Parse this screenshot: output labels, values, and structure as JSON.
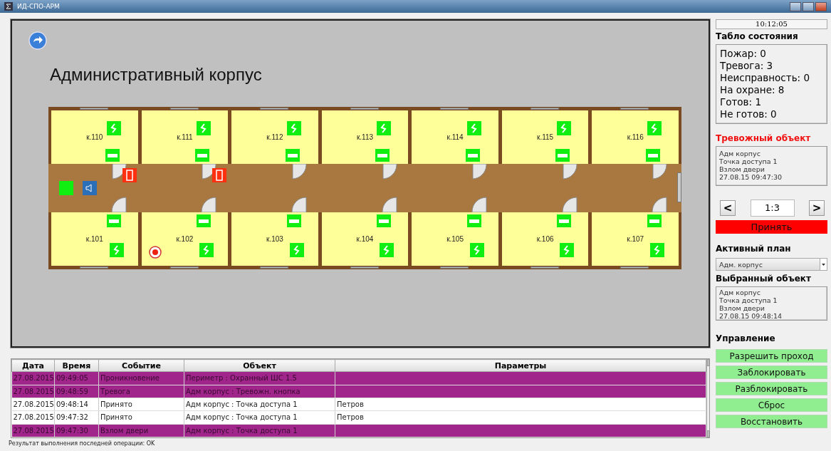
{
  "window": {
    "title": "ИД-СПО-АРМ"
  },
  "plan": {
    "title": "Административный корпус",
    "top_rooms": [
      {
        "label": "к.110",
        "door_alarm": true
      },
      {
        "label": "к.111",
        "door_alarm": true
      },
      {
        "label": "к.112",
        "door_alarm": false
      },
      {
        "label": "к.113",
        "door_alarm": false
      },
      {
        "label": "к.114",
        "door_alarm": false
      },
      {
        "label": "к.115",
        "door_alarm": false
      },
      {
        "label": "к.116",
        "door_alarm": false
      }
    ],
    "bottom_rooms": [
      {
        "label": "к.101",
        "marker": false
      },
      {
        "label": "к.102",
        "marker": true
      },
      {
        "label": "к.103",
        "marker": false
      },
      {
        "label": "к.104",
        "marker": false
      },
      {
        "label": "к.105",
        "marker": false
      },
      {
        "label": "к.106",
        "marker": false
      },
      {
        "label": "к.107",
        "marker": false
      }
    ]
  },
  "events": {
    "columns": [
      "Дата",
      "Время",
      "Событие",
      "Объект",
      "Параметры"
    ],
    "rows": [
      {
        "alarm": true,
        "cells": [
          "27.08.2015",
          "09:49:05",
          "Проникновение",
          "Периметр : Охранный ШС 1.5",
          ""
        ]
      },
      {
        "alarm": true,
        "cells": [
          "27.08.2015",
          "09:48:59",
          "Тревога",
          "Адм корпус : Тревожн. кнопка",
          ""
        ]
      },
      {
        "alarm": false,
        "cells": [
          "27.08.2015",
          "09:48:14",
          "Принято",
          "Адм корпус : Точка доступа 1",
          "Петров"
        ]
      },
      {
        "alarm": false,
        "cells": [
          "27.08.2015",
          "09:47:32",
          "Принято",
          "Адм корпус : Точка доступа 1",
          "Петров"
        ]
      },
      {
        "alarm": true,
        "cells": [
          "27.08.2015",
          "09:47:30",
          "Взлом двери",
          "Адм корпус : Точка доступа 1",
          ""
        ]
      }
    ]
  },
  "status_bar": "Результат выполнения последней операции: OK",
  "side": {
    "clock": "10:12:05",
    "status_title": "Табло состояния",
    "status_lines": [
      "Пожар: 0",
      "Тревога: 3",
      "Неисправность: 0",
      "На охране: 8",
      "Готов: 1",
      "Не готов: 0"
    ],
    "alarm_title": "Тревожный объект",
    "alarm_lines": [
      "Адм корпус",
      "Точка доступа 1",
      "Взлом двери",
      "27.08.15 09:47:30"
    ],
    "prev": "<",
    "page": "1:3",
    "next": ">",
    "accept": "Принять",
    "plan_title": "Активный план",
    "plan_value": "Адм. корпус",
    "selected_title": "Выбранный объект",
    "selected_lines": [
      "Адм корпус",
      "Точка доступа 1",
      "Взлом двери",
      "27.08.15 09:48:14"
    ],
    "control_title": "Управление",
    "controls": [
      "Разрешить проход",
      "Заблокировать",
      "Разблокировать",
      "Сброс",
      "Восстановить"
    ]
  }
}
